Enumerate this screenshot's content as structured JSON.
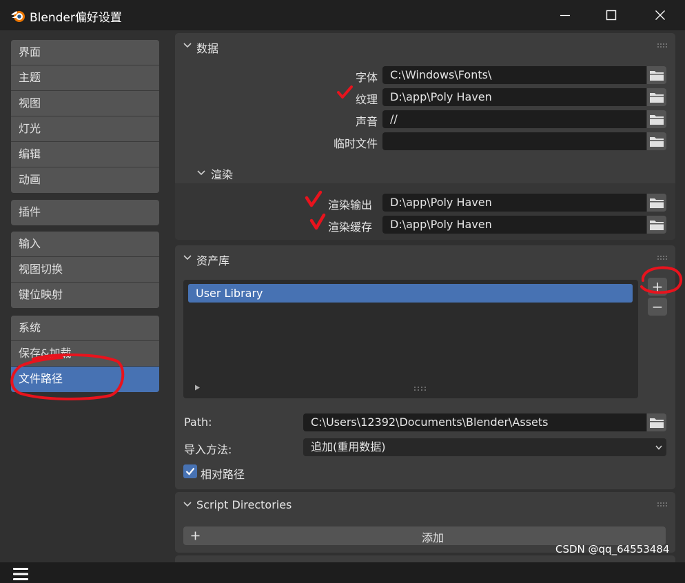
{
  "window": {
    "title": "Blender偏好设置"
  },
  "sidebar": {
    "groups": [
      [
        "界面",
        "主题",
        "视图",
        "灯光",
        "编辑",
        "动画"
      ],
      [
        "插件"
      ],
      [
        "输入",
        "视图切换",
        "键位映射"
      ],
      [
        "系统",
        "保存&加载",
        "文件路径"
      ]
    ],
    "active_item": "文件路径"
  },
  "data_panel": {
    "title": "数据",
    "fields": [
      {
        "label": "字体",
        "value": "C:\\Windows\\Fonts\\"
      },
      {
        "label": "纹理",
        "value": "D:\\app\\Poly Haven"
      },
      {
        "label": "声音",
        "value": "//"
      },
      {
        "label": "临时文件",
        "value": ""
      }
    ],
    "render": {
      "title": "渲染",
      "fields": [
        {
          "label": "渲染输出",
          "value": "D:\\app\\Poly Haven"
        },
        {
          "label": "渲染缓存",
          "value": "D:\\app\\Poly Haven"
        }
      ]
    }
  },
  "asset_panel": {
    "title": "资产库",
    "libraries": [
      "User Library"
    ],
    "add_symbol": "+",
    "remove_symbol": "−",
    "path_label": "Path:",
    "path_value": "C:\\Users\\12392\\Documents\\Blender\\Assets",
    "import_label": "导入方法:",
    "import_value": "追加(重用数据)",
    "relative_label": "相对路径",
    "relative_checked": true
  },
  "script_panel": {
    "title": "Script Directories",
    "add_label": "添加"
  },
  "watermark": "CSDN @qq_64553484",
  "colors": {
    "accent": "#4772b3",
    "annotation": "#e8131d"
  },
  "icons": {
    "logo": "blender-logo-icon",
    "folder": "folder-icon",
    "menu": "hamburger-menu-icon"
  }
}
